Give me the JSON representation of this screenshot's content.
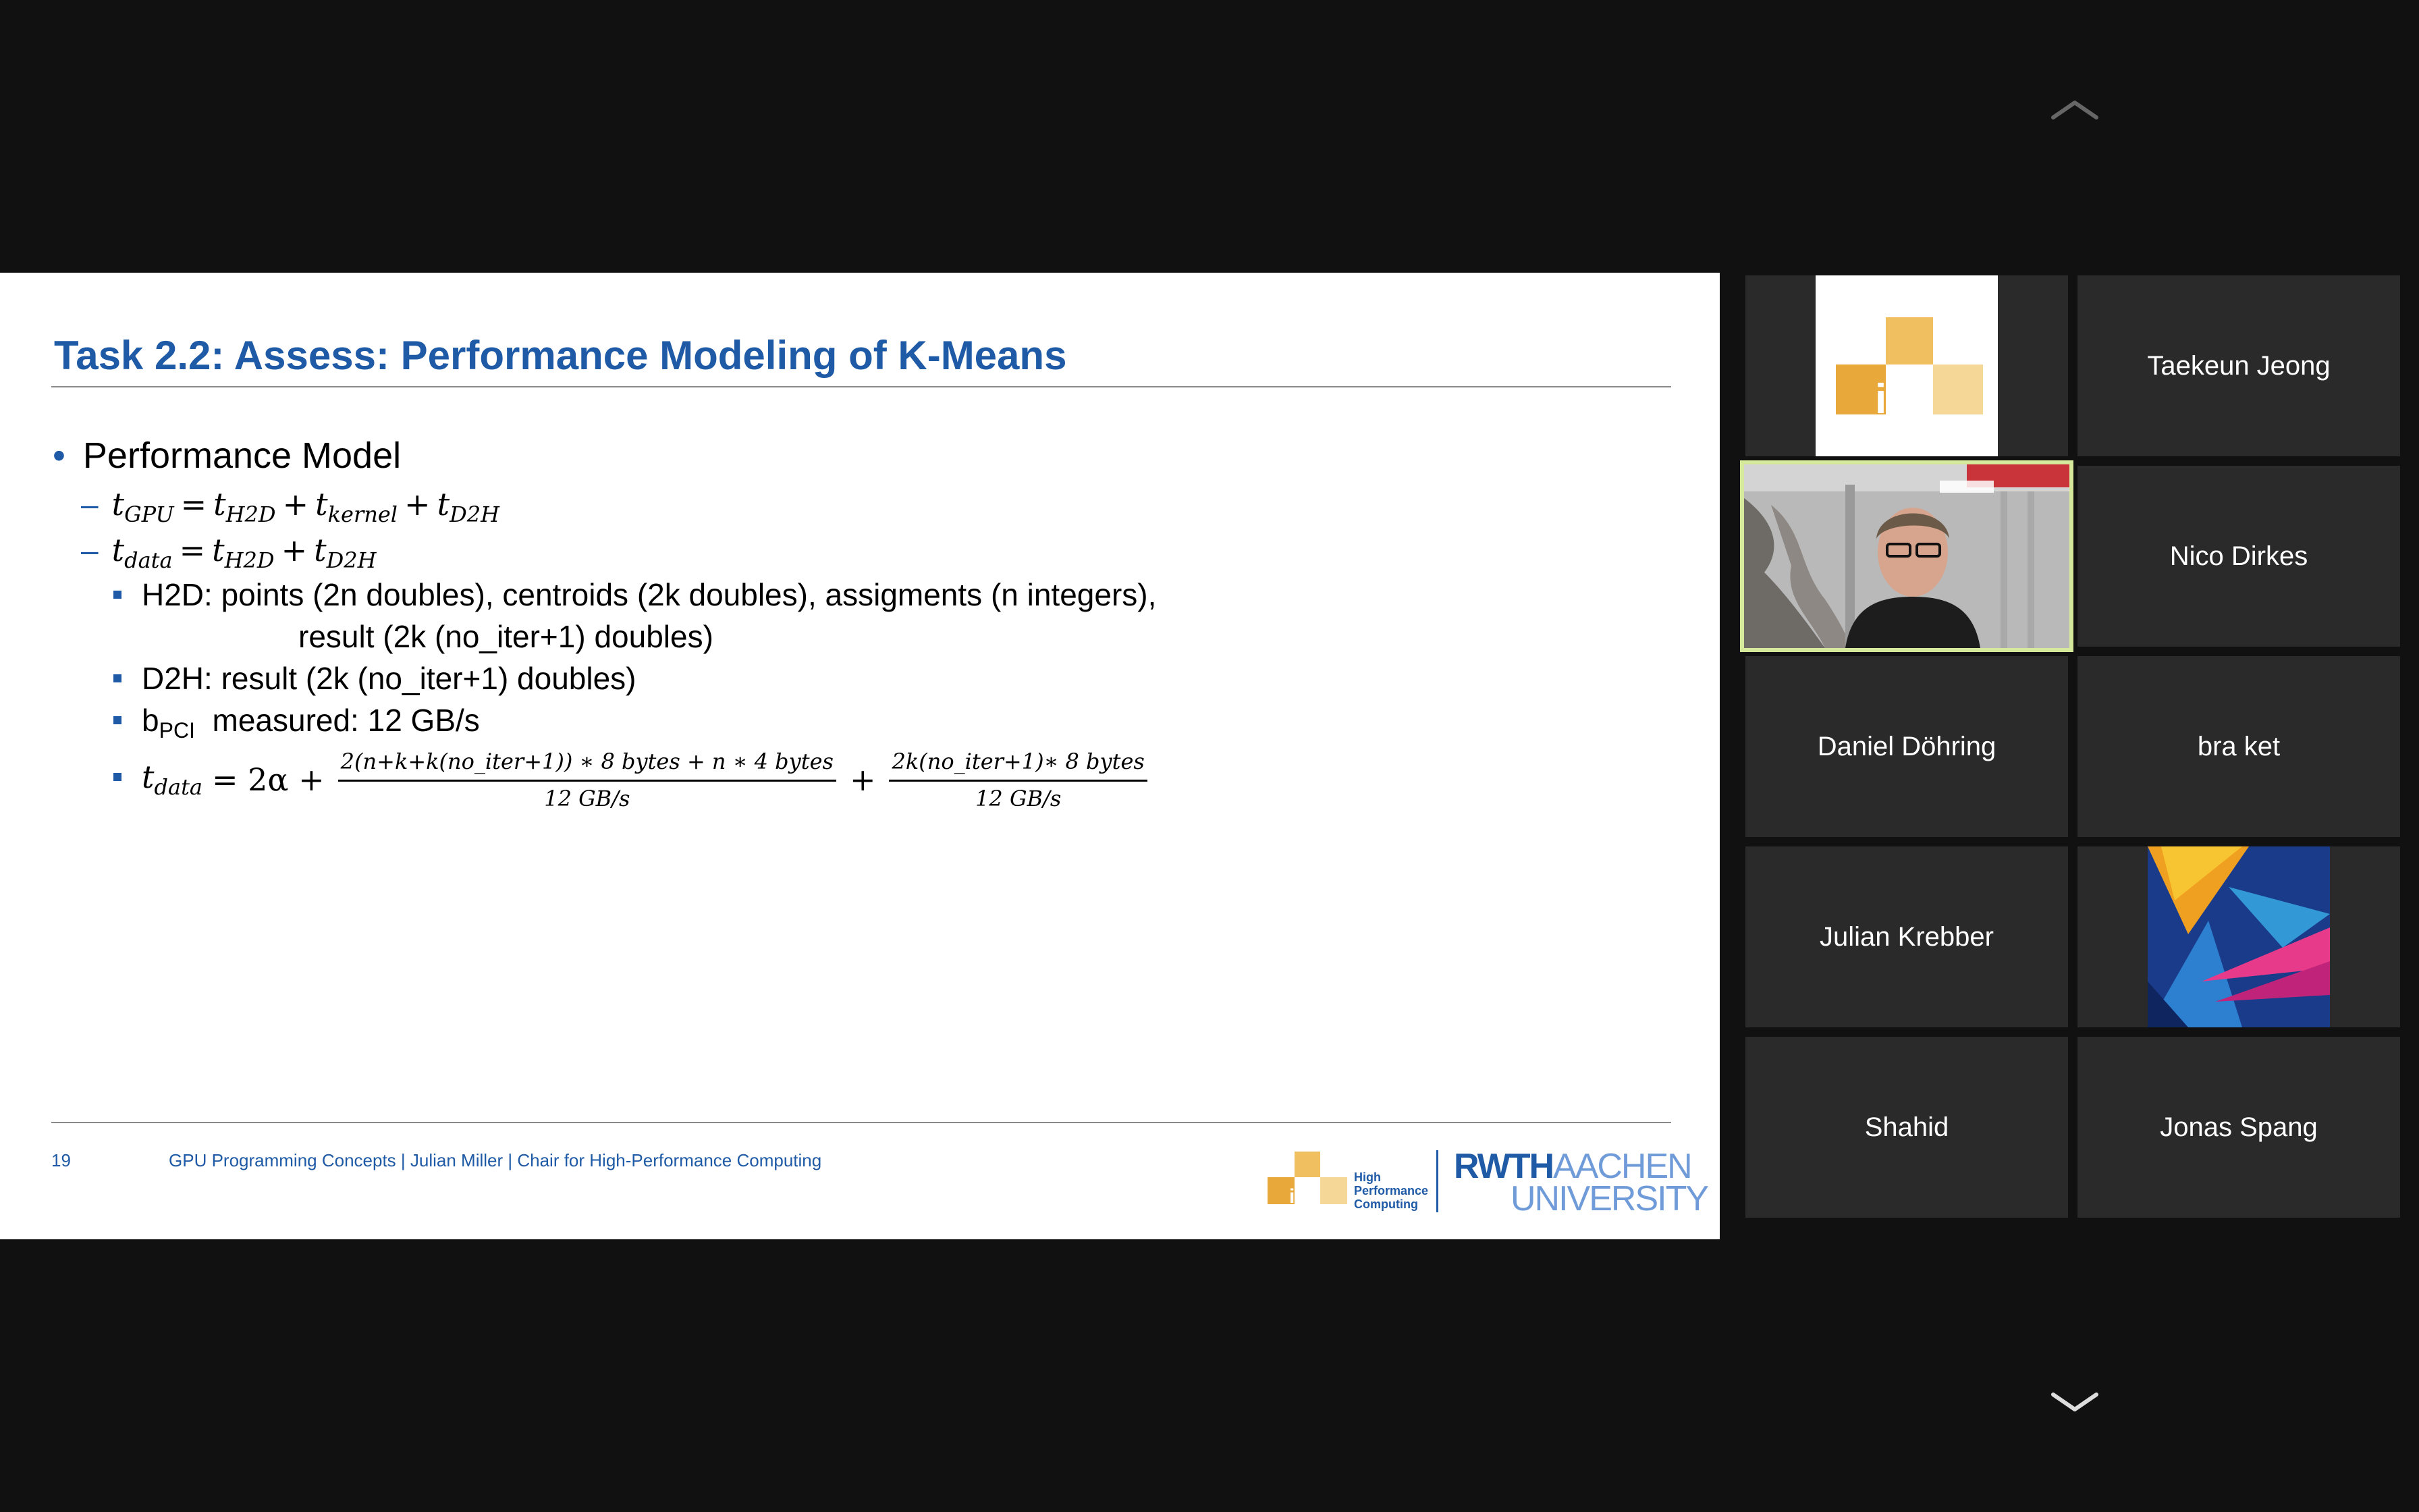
{
  "slide": {
    "title": "Task 2.2: Assess: Performance Modeling of K-Means",
    "bullet": "Performance Model",
    "eq_gpu": {
      "lhs": "t",
      "lhs_sub": "GPU",
      "eq": "=",
      "t1": "t",
      "t1_sub": "H2D",
      "plus1": "+",
      "t2": "t",
      "t2_sub": "kernel",
      "plus2": "+",
      "t3": "t",
      "t3_sub": "D2H"
    },
    "eq_data": {
      "lhs": "t",
      "lhs_sub": "data",
      "eq": "=",
      "t1": "t",
      "t1_sub": "H2D",
      "plus1": "+",
      "t2": "t",
      "t2_sub": "D2H"
    },
    "h2d_line1": "H2D: points (2n doubles), centroids (2k doubles), assigments (n integers),",
    "h2d_line2": "result (2k (no_iter+1) doubles)",
    "d2h": "D2H: result (2k (no_iter+1) doubles)",
    "bpci_b": "b",
    "bpci_sub": "PCI",
    "bpci_rest": "measured: 12 GB/s",
    "formula": {
      "lhs": "t",
      "lhs_sub": "data",
      "eq": "= 2α +",
      "num1": "2(n+k+k(no_iter+1)) ∗ 8 bytes + n ∗ 4 bytes",
      "den1": "12 GB/s",
      "plus": "+",
      "num2": "2k(no_iter+1)∗ 8 bytes",
      "den2": "12 GB/s"
    },
    "footer": {
      "page": "19",
      "text": "GPU Programming Concepts |  Julian Miller |  Chair for High-Performance Computing"
    },
    "logo": {
      "i12": "i12",
      "hpc_words": [
        "High",
        "Performance",
        "Computing"
      ],
      "rwth_bold": "RWTH",
      "rwth_light": "AACHEN",
      "university": "UNIVERSITY"
    }
  },
  "participants": [
    {
      "name": "",
      "avatar": "i12-logo",
      "i12": "i12"
    },
    {
      "name": "Taekeun Jeong"
    },
    {
      "name": "",
      "avatar": "live-video",
      "active_speaker": true
    },
    {
      "name": "Nico Dirkes"
    },
    {
      "name": "Daniel Döhring"
    },
    {
      "name": "bra ket"
    },
    {
      "name": "Julian Krebber"
    },
    {
      "name": "",
      "avatar": "abstract-art"
    },
    {
      "name": "Shahid"
    },
    {
      "name": "Jonas Spang"
    }
  ],
  "colors": {
    "background": "#111111",
    "tile": "#2a2a2a",
    "slide_blue": "#1f5aa6",
    "active_border": "#d6e99a",
    "i12_orange": "#e8a93a"
  },
  "icons": {
    "scroll_up": "chevron-up-icon",
    "scroll_down": "chevron-down-icon"
  }
}
